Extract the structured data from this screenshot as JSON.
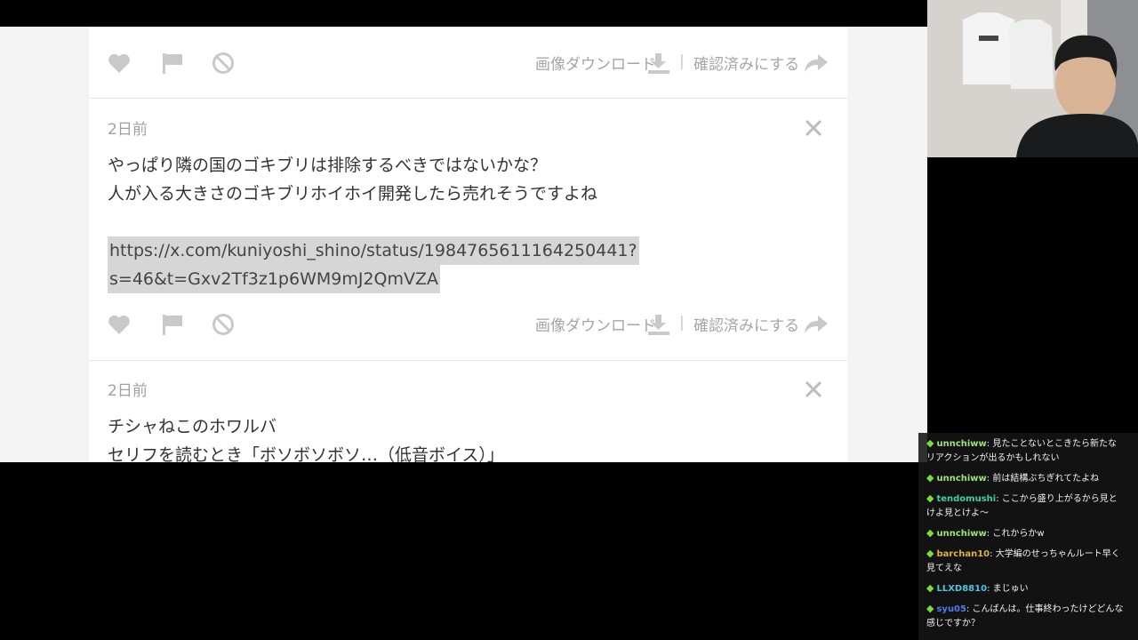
{
  "cards": [
    {
      "actions": {
        "download_label": "画像ダウンロード",
        "separator": "|",
        "confirm_label": "確認済みにする"
      }
    },
    {
      "timestamp": "2日前",
      "lines": [
        "やっぱり隣の国のゴキブリは排除するべきではないかな？",
        "人が入る大きさのゴキブリホイホイ開発したら売れそうですよね"
      ],
      "url_lines": [
        "https://x.com/kuniyoshi_shino/status/1984765611164250441?",
        "s=46&t=Gxv2Tf3z1p6WM9mJ2QmVZA"
      ],
      "actions": {
        "download_label": "画像ダウンロード",
        "separator": "|",
        "confirm_label": "確認済みにする"
      }
    },
    {
      "timestamp": "2日前",
      "lines": [
        "チシャねこのホワルバ",
        "セリフを読むとき「ボソボソボソ…（低音ボイス）」"
      ]
    }
  ],
  "chat": {
    "messages": [
      {
        "user": "unnchiww",
        "color": "#9ee37d",
        "text": "見たことないとこきたら新たなリアクションが出るかもしれない"
      },
      {
        "user": "unnchiww",
        "color": "#9ee37d",
        "text": "前は結構ぶちぎれてたよね"
      },
      {
        "user": "tendomushi",
        "color": "#3fd0a0",
        "text": "ここから盛り上がるから見とけよ見とけよ～"
      },
      {
        "user": "unnchiww",
        "color": "#9ee37d",
        "text": "これからかw"
      },
      {
        "user": "barchan10",
        "color": "#e0b040",
        "text": "大学編のせっちゃんルート早く見てえな"
      },
      {
        "user": "LLXD8810",
        "color": "#4fc4e0",
        "text": "まじゅい"
      },
      {
        "user": "syu05",
        "color": "#4a7ef0",
        "text": "こんばんは。仕事終わったけどどんな感じですか？"
      }
    ]
  },
  "icons": {
    "heart": "heart-icon",
    "flag": "flag-icon",
    "block": "block-icon",
    "download": "download-icon",
    "share": "share-arrow-icon",
    "close": "close-icon",
    "gem": "diamond-icon"
  },
  "colors": {
    "icon_gray": "#c9c9c9",
    "text_gray": "#a5a5a5",
    "url_highlight": "#d6d6d6"
  }
}
